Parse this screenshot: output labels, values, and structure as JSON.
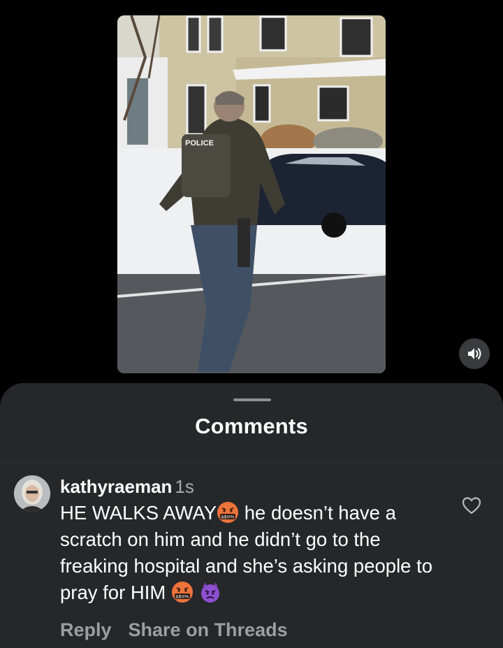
{
  "video": {
    "vest_label": "POLICE",
    "mute_icon": "speaker-icon"
  },
  "comments_sheet": {
    "title": "Comments"
  },
  "comment": {
    "username": "kathyraeman",
    "timestamp": "1s",
    "text_part1": "HE WALKS AWAY",
    "text_part2": " he doesn’t have a scratch on him and he didn’t go to the freaking hospital and she’s asking people to pray for HIM",
    "emoji_1": "cursing-face-emoji",
    "emoji_2": "cursing-face-emoji",
    "emoji_3": "angry-devil-emoji",
    "like_icon": "heart-icon",
    "actions": {
      "reply": "Reply",
      "share": "Share on Threads"
    }
  },
  "colors": {
    "background": "#000000",
    "sheet": "#262729",
    "text_primary": "#ffffff",
    "text_secondary": "#9d9ea2"
  }
}
